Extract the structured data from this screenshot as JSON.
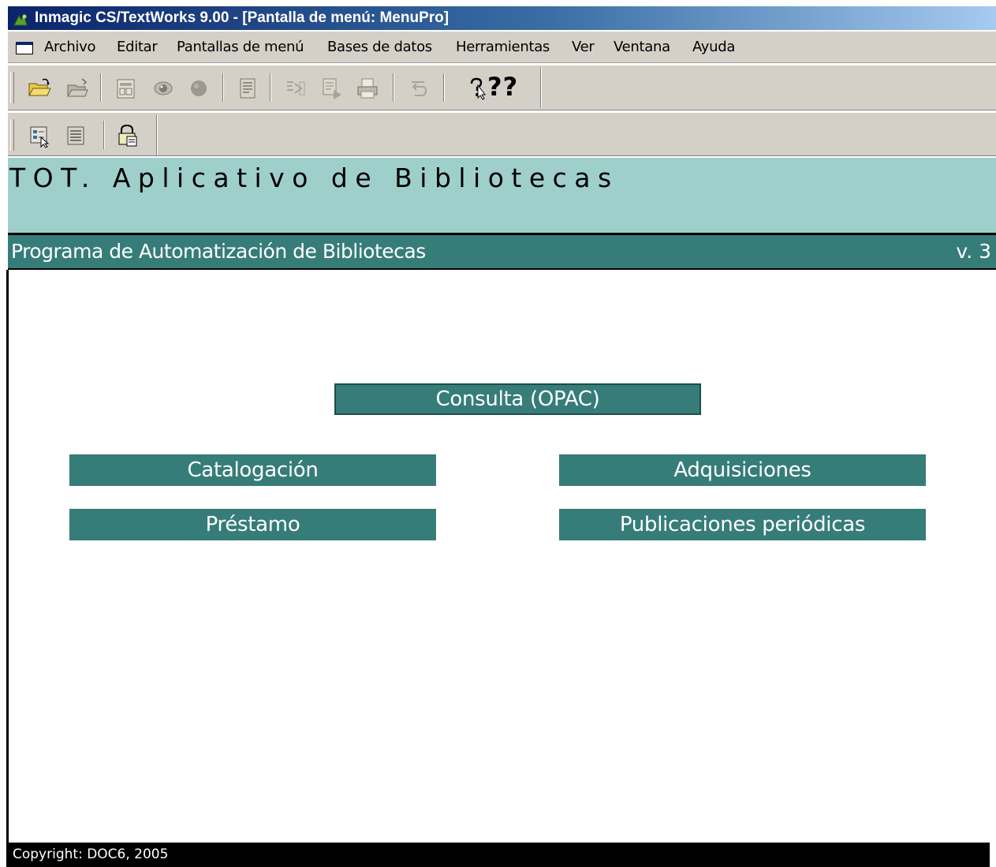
{
  "window": {
    "title": "Inmagic CS/TextWorks 9.00  - [Pantalla de menú: MenuPro]"
  },
  "menu": {
    "items": [
      "Archivo",
      "Editar",
      "Pantallas de menú",
      "Bases de datos",
      "Herramientas",
      "Ver",
      "Ventana",
      "Ayuda"
    ]
  },
  "toolbar1": {
    "icons": [
      "open-folder-icon",
      "open-database-icon",
      "form-icon",
      "view-icon",
      "record-dot-icon",
      "report-icon",
      "import-icon",
      "export-icon",
      "print-icon",
      "undo-icon",
      "help-icon"
    ],
    "help_marks": "??"
  },
  "toolbar2": {
    "icons": [
      "menu-screen-icon",
      "list-icon",
      "lock-database-icon"
    ]
  },
  "header": {
    "title": "TOT. Aplicativo de Bibliotecas",
    "subtitle": "Programa de Automatización de Bibliotecas",
    "version": "v. 3"
  },
  "modules": {
    "consulta": "Consulta (OPAC)",
    "catalogacion": "Catalogación",
    "adquisiciones": "Adquisiciones",
    "prestamo": "Préstamo",
    "periodicas": "Publicaciones periódicas"
  },
  "status": {
    "copyright": "Copyright: DOC6, 2005"
  },
  "colors": {
    "header_bg": "#9fcfcb",
    "accent": "#367d79",
    "titlebar": "#0a246a",
    "chrome": "#d4d0c8"
  }
}
